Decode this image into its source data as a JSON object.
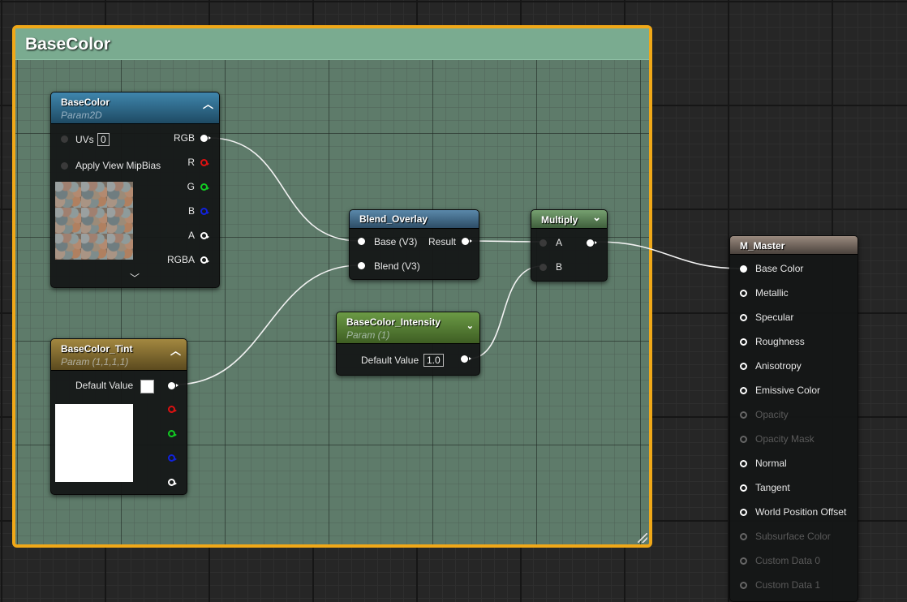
{
  "comment": {
    "title": "BaseColor"
  },
  "nodes": {
    "basecolor_tex": {
      "title": "BaseColor",
      "subtitle": "Param2D",
      "uvs_label": "UVs",
      "uvs_value": "0",
      "mipbias_label": "Apply View MipBias",
      "outputs": [
        "RGB",
        "R",
        "G",
        "B",
        "A",
        "RGBA"
      ],
      "head_color": "#2f6f92"
    },
    "tint": {
      "title": "BaseColor_Tint",
      "subtitle": "Param (1,1,1,1)",
      "default_label": "Default Value",
      "head_color": "#8a7230"
    },
    "blend": {
      "title": "Blend_Overlay",
      "inputs": [
        "Base (V3)",
        "Blend (V3)"
      ],
      "output": "Result",
      "head_color": "#4d7899"
    },
    "intensity": {
      "title": "BaseColor_Intensity",
      "subtitle": "Param (1)",
      "default_label": "Default Value",
      "default_value": "1.0",
      "head_color": "#5d8a3a"
    },
    "multiply": {
      "title": "Multiply",
      "inputs": [
        "A",
        "B"
      ],
      "head_color": "#5e8a5a"
    },
    "master": {
      "title": "M_Master",
      "head_color": "#7a6f66",
      "inputs": [
        {
          "label": "Base Color",
          "active": true,
          "connected": true
        },
        {
          "label": "Metallic",
          "active": true
        },
        {
          "label": "Specular",
          "active": true
        },
        {
          "label": "Roughness",
          "active": true
        },
        {
          "label": "Anisotropy",
          "active": true
        },
        {
          "label": "Emissive Color",
          "active": true
        },
        {
          "label": "Opacity",
          "active": false
        },
        {
          "label": "Opacity Mask",
          "active": false
        },
        {
          "label": "Normal",
          "active": true
        },
        {
          "label": "Tangent",
          "active": true
        },
        {
          "label": "World Position Offset",
          "active": true
        },
        {
          "label": "Subsurface Color",
          "active": false
        },
        {
          "label": "Custom Data 0",
          "active": false
        },
        {
          "label": "Custom Data 1",
          "active": false
        }
      ]
    }
  },
  "colors": {
    "comment_border": "#f0a818",
    "comment_header": "#7aab90",
    "wire": "#ffffff"
  }
}
